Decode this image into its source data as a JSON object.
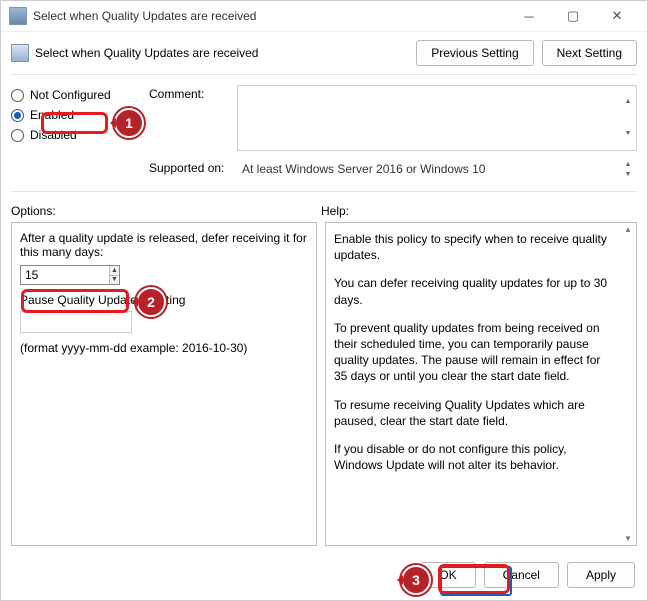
{
  "titlebar": {
    "title": "Select when Quality Updates are received"
  },
  "header": {
    "title": "Select when Quality Updates are received",
    "prev_btn": "Previous Setting",
    "next_btn": "Next Setting"
  },
  "state": {
    "not_configured": "Not Configured",
    "enabled": "Enabled",
    "disabled": "Disabled",
    "selected": "enabled"
  },
  "fields": {
    "comment_label": "Comment:",
    "supported_label": "Supported on:",
    "supported_text": "At least Windows Server 2016 or Windows 10"
  },
  "labels": {
    "options": "Options:",
    "help": "Help:"
  },
  "options": {
    "defer_label": "After a quality update is released, defer receiving it for this many days:",
    "defer_value": "15",
    "pause_label": "Pause Quality Updates starting",
    "pause_value": "",
    "format_note": "(format yyyy-mm-dd example: 2016-10-30)"
  },
  "help": {
    "p1": "Enable this policy to specify when to receive quality updates.",
    "p2": "You can defer receiving quality updates for up to 30 days.",
    "p3": "To prevent quality updates from being received on their scheduled time, you can temporarily pause quality updates. The pause will remain in effect for 35 days or until you clear the start date field.",
    "p4": "To resume receiving Quality Updates which are paused, clear the start date field.",
    "p5": "If you disable or do not configure this policy, Windows Update will not alter its behavior."
  },
  "footer": {
    "ok": "OK",
    "cancel": "Cancel",
    "apply": "Apply"
  },
  "annotations": {
    "b1": "1",
    "b2": "2",
    "b3": "3"
  }
}
